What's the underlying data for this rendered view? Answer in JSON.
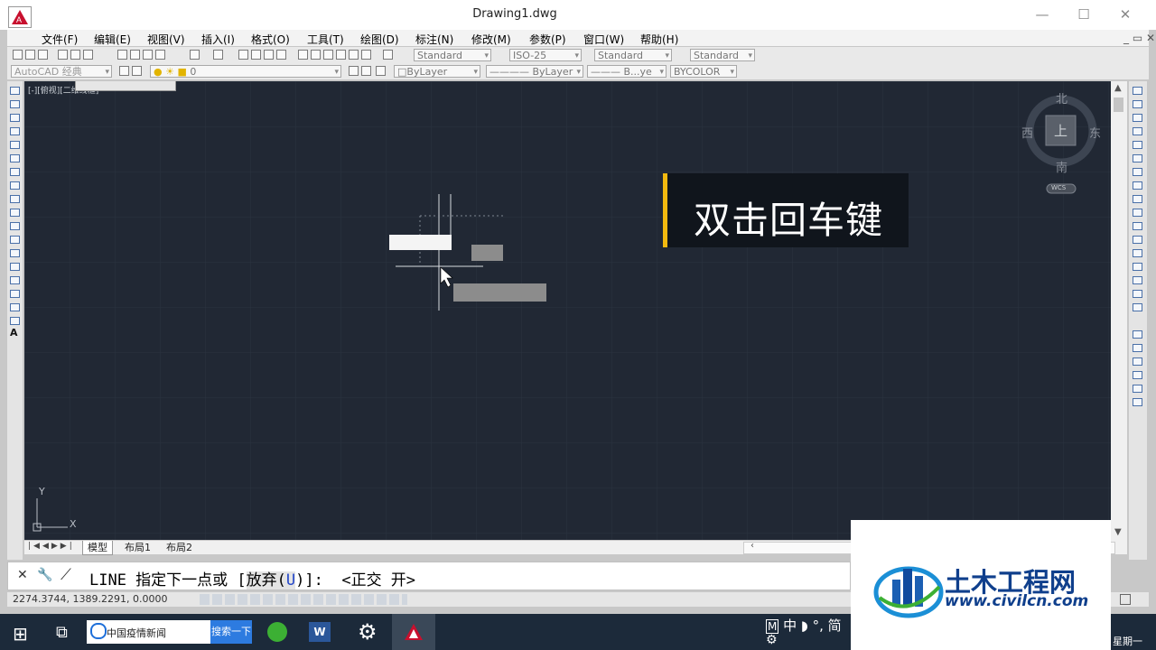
{
  "window": {
    "title": "Drawing1.dwg",
    "minimize": "—",
    "maximize": "☐",
    "close": "✕"
  },
  "menu": [
    "文件(F)",
    "编辑(E)",
    "视图(V)",
    "插入(I)",
    "格式(O)",
    "工具(T)",
    "绘图(D)",
    "标注(N)",
    "修改(M)",
    "参数(P)",
    "窗口(W)",
    "帮助(H)"
  ],
  "toolbar1": {
    "text_style": "Standard",
    "dim_style": "ISO-25",
    "table_style": "Standard",
    "multileader_style": "Standard"
  },
  "toolbar2": {
    "workspace": "AutoCAD 经典",
    "layer": "0",
    "color": "ByLayer",
    "linetype": "ByLayer",
    "lineweight": "B...ye",
    "plotstyle": "BYCOLOR"
  },
  "viewport_label": "[-][俯视][二维线框]",
  "viewcube": {
    "north": "北",
    "south": "南",
    "east": "东",
    "west": "西",
    "face": "上",
    "wcs": "WCS"
  },
  "ucs": {
    "x": "X",
    "y": "Y"
  },
  "layout_tabs": [
    "模型",
    "布局1",
    "布局2"
  ],
  "command_line": {
    "prefix": "LINE 指定下一点或 [",
    "option": "放弃(",
    "option_key": "U",
    "suffix": ")]:  <正交 开>"
  },
  "status": {
    "coordinates": "2274.3744, 1389.2291, 0.0000"
  },
  "caption": "双击回车键",
  "watermark": {
    "brand": "土木工程网",
    "url": "www.civilcn.com"
  },
  "taskbar": {
    "search_text": "中国疫情新闻",
    "search_button": "搜索一下",
    "tray_text": "中 ◗ °, 简",
    "weekday": "星期一"
  },
  "colors": {
    "canvas": "#212834",
    "caption_accent": "#f2b90f",
    "autocad_red": "#c8102e",
    "brand_blue": "#1b5fb3"
  }
}
